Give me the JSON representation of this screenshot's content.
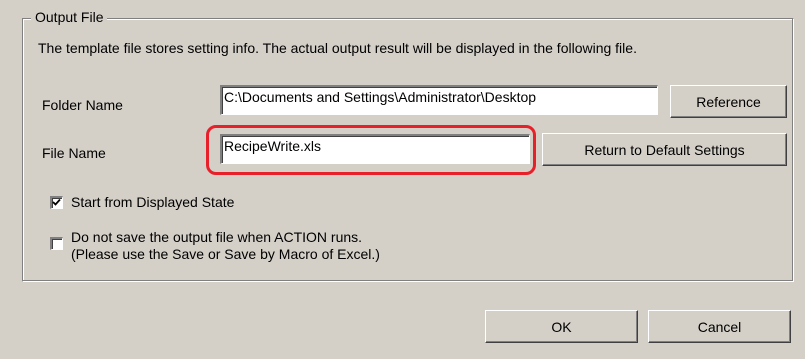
{
  "group": {
    "title": "Output File"
  },
  "description": "The template file stores setting info. The actual output result will be displayed in the following file.",
  "folder": {
    "label": "Folder Name",
    "value": "C:\\Documents and Settings\\Administrator\\Desktop",
    "button": "Reference"
  },
  "file": {
    "label": "File Name",
    "value": "RecipeWrite.xls",
    "button": "Return to Default Settings"
  },
  "options": {
    "start_displayed": {
      "label": "Start from Displayed State",
      "checked": true
    },
    "no_save": {
      "line1": "Do not save the output file when ACTION runs.",
      "line2": "(Please use the Save or Save by Macro of Excel.)",
      "checked": false
    }
  },
  "footer": {
    "ok": "OK",
    "cancel": "Cancel"
  },
  "colors": {
    "highlight": "#e8202a",
    "dialog_bg": "#d4d0c8"
  }
}
